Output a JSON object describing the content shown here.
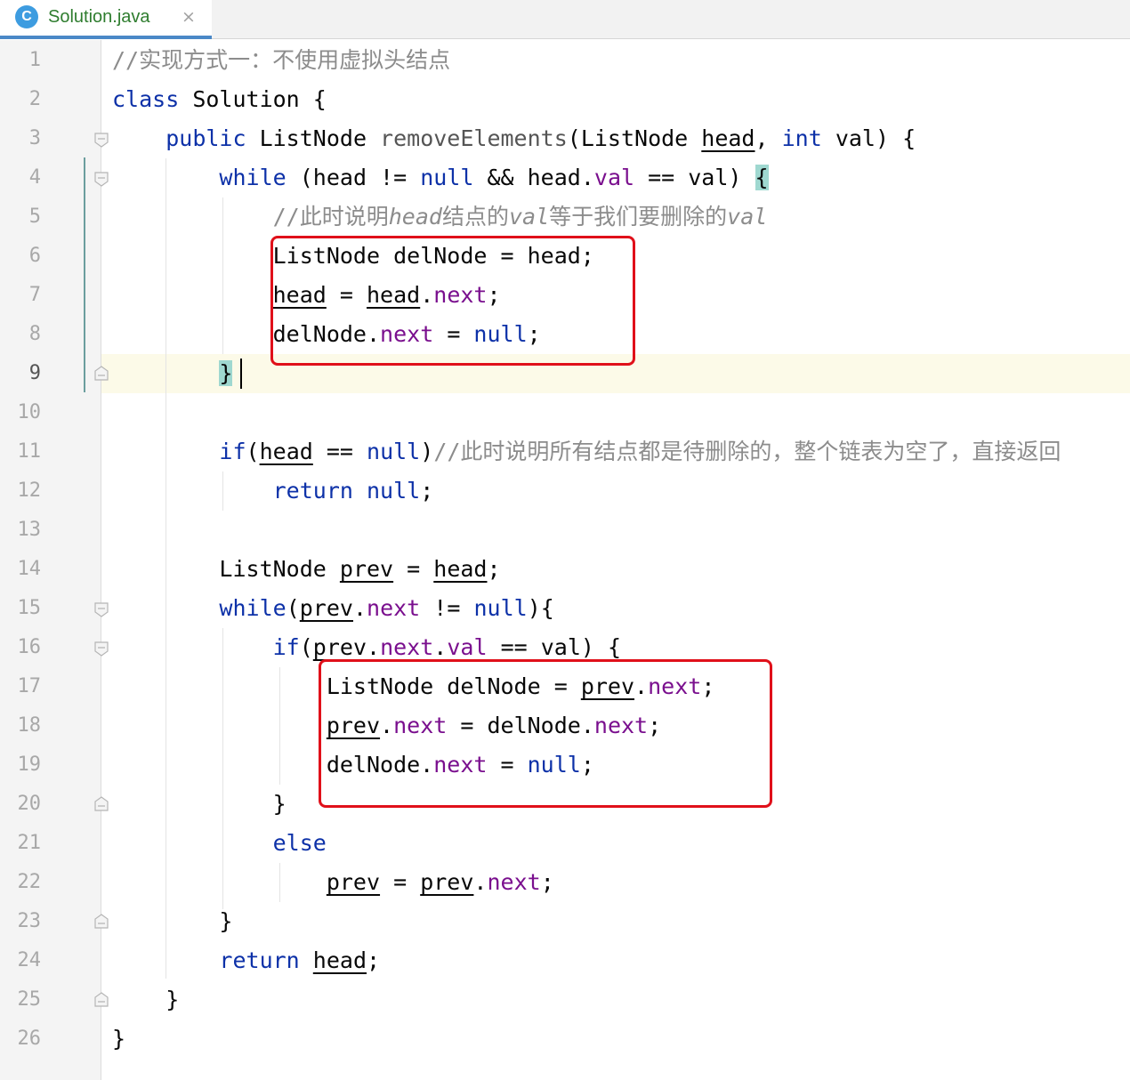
{
  "tab": {
    "icon_letter": "C",
    "file_name": "Solution.java",
    "close_glyph": "×"
  },
  "colors": {
    "keyword": "#0d31a8",
    "field": "#7a0f8e",
    "comment": "#8c8c8c",
    "highlight_box": "#e0101a",
    "current_line": "#fcfae8"
  },
  "editor": {
    "current_line": 9,
    "line_numbers": [
      "1",
      "2",
      "3",
      "4",
      "5",
      "6",
      "7",
      "8",
      "9",
      "10",
      "11",
      "12",
      "13",
      "14",
      "15",
      "16",
      "17",
      "18",
      "19",
      "20",
      "21",
      "22",
      "23",
      "24",
      "25",
      "26"
    ],
    "lines": {
      "l1": {
        "comment": "//实现方式一：不使用虚拟头结点"
      },
      "l2": {
        "kw_class": "class",
        "rest": " Solution {"
      },
      "l3": {
        "kw_public": "public",
        "t1": " ListNode ",
        "method": "removeElements",
        "t2": "(ListNode ",
        "param_head": "head",
        "t3": ", ",
        "kw_int": "int",
        "t4": " val) {"
      },
      "l4": {
        "kw_while": "while",
        "t1": " (head != ",
        "kw_null": "null",
        "t2": " && head.",
        "fld_val": "val",
        "t3": " == val) ",
        "brace": "{"
      },
      "l5": {
        "c1": "//此时说明",
        "ci1": "head",
        "c2": "结点的",
        "ci2": "val",
        "c3": "等于我们要删除的",
        "ci3": "val"
      },
      "l6": {
        "text": "ListNode delNode = head;"
      },
      "l7": {
        "v1": "head",
        "t1": " = ",
        "v2": "head",
        "t2": ".",
        "fld_next": "next",
        "t3": ";"
      },
      "l8": {
        "t1": "delNode.",
        "fld_next": "next",
        "t2": " = ",
        "kw_null": "null",
        "t3": ";"
      },
      "l9": {
        "brace": "}"
      },
      "l11": {
        "kw_if": "if",
        "t1": "(",
        "v_head": "head",
        "t2": " == ",
        "kw_null": "null",
        "t3": ")",
        "comment": "//此时说明所有结点都是待删除的，整个链表为空了，直接返回"
      },
      "l12": {
        "kw_return": "return",
        "t1": " ",
        "kw_null": "null",
        "t2": ";"
      },
      "l14": {
        "t1": "ListNode ",
        "v_prev": "prev",
        "t2": " = ",
        "v_head": "head",
        "t3": ";"
      },
      "l15": {
        "kw_while": "while",
        "t1": "(",
        "v_prev": "prev",
        "t2": ".",
        "fld_next": "next",
        "t3": " != ",
        "kw_null": "null",
        "t4": "){"
      },
      "l16": {
        "kw_if": "if",
        "t1": "(",
        "v_prev": "prev",
        "t2": ".",
        "fld_next": "next",
        "t3": ".",
        "fld_val": "val",
        "t4": " == val) {"
      },
      "l17": {
        "t1": "ListNode delNode = ",
        "v_prev": "prev",
        "t2": ".",
        "fld_next": "next",
        "t3": ";"
      },
      "l18": {
        "v_prev": "prev",
        "t1": ".",
        "fld_next1": "next",
        "t2": " = delNode.",
        "fld_next2": "next",
        "t3": ";"
      },
      "l19": {
        "t1": "delNode.",
        "fld_next": "next",
        "t2": " = ",
        "kw_null": "null",
        "t3": ";"
      },
      "l20": {
        "text": "}"
      },
      "l21": {
        "kw_else": "else"
      },
      "l22": {
        "v_prev1": "prev",
        "t1": " = ",
        "v_prev2": "prev",
        "t2": ".",
        "fld_next": "next",
        "t3": ";"
      },
      "l23": {
        "text": "}"
      },
      "l24": {
        "kw_return": "return",
        "t1": " ",
        "v_head": "head",
        "t2": ";"
      },
      "l25": {
        "text": "}"
      },
      "l26": {
        "text": "}"
      }
    }
  }
}
